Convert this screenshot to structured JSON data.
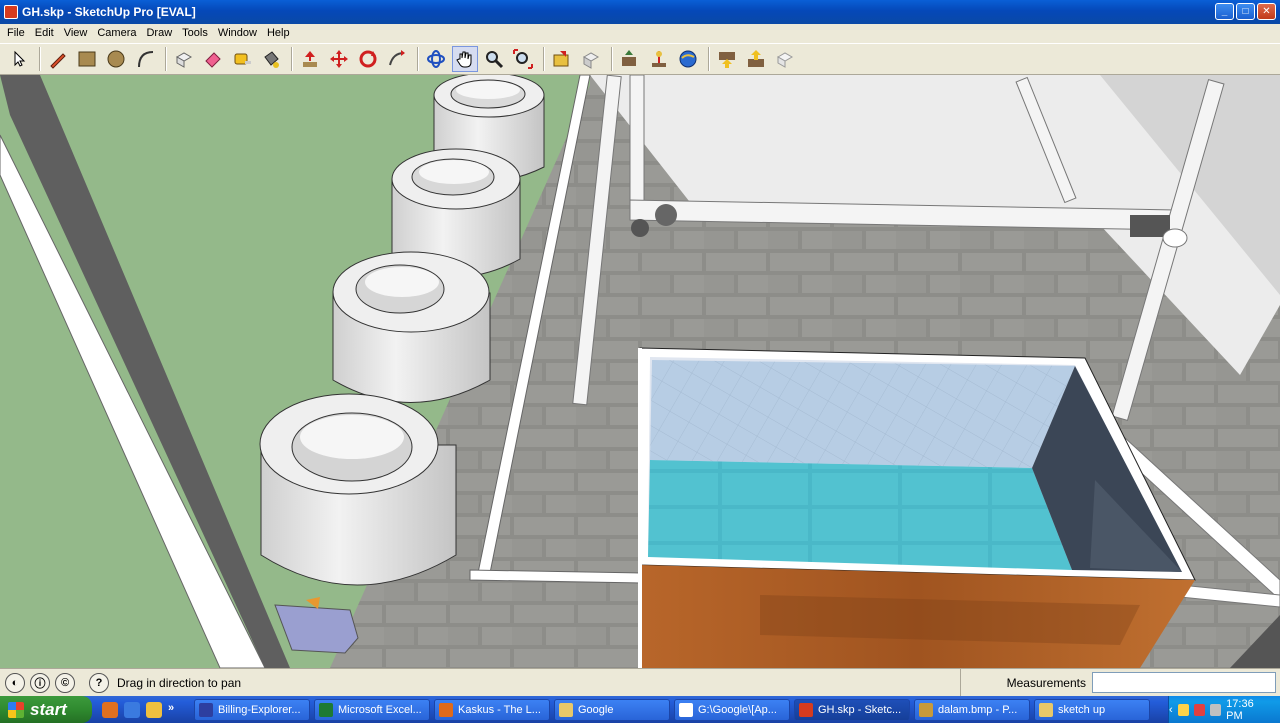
{
  "window": {
    "title": "GH.skp - SketchUp Pro [EVAL]",
    "controls": {
      "minimize": "_",
      "maximize": "□",
      "close": "✕"
    }
  },
  "menu": [
    "File",
    "Edit",
    "View",
    "Camera",
    "Draw",
    "Tools",
    "Window",
    "Help"
  ],
  "toolbar": {
    "tools": [
      {
        "name": "select-icon"
      },
      {
        "name": "pencil-icon"
      },
      {
        "name": "rectangle-icon"
      },
      {
        "name": "circle-icon"
      },
      {
        "name": "arc-icon"
      },
      {
        "name": "make-component-icon"
      },
      {
        "name": "eraser-icon"
      },
      {
        "name": "tape-measure-icon"
      },
      {
        "name": "paint-bucket-icon"
      },
      {
        "name": "push-pull-icon"
      },
      {
        "name": "move-icon"
      },
      {
        "name": "rotate-icon"
      },
      {
        "name": "follow-me-icon"
      },
      {
        "name": "orbit-icon"
      },
      {
        "name": "pan-icon",
        "active": true
      },
      {
        "name": "zoom-icon"
      },
      {
        "name": "zoom-extents-icon"
      },
      {
        "name": "get-models-icon"
      },
      {
        "name": "share-model-icon"
      },
      {
        "name": "share-component-icon"
      },
      {
        "name": "add-location-icon"
      },
      {
        "name": "google-earth-icon"
      },
      {
        "name": "import-icon"
      },
      {
        "name": "export-icon"
      },
      {
        "name": "preview-icon"
      }
    ]
  },
  "status": {
    "hint": "Drag in direction to pan",
    "help_icon": "?",
    "measurements_label": "Measurements",
    "measurements_value": ""
  },
  "taskbar": {
    "start_label": "start",
    "more_arrow": "»",
    "tasks": [
      {
        "label": "Billing-Explorer...",
        "color": "#2d3fa0"
      },
      {
        "label": "Microsoft Excel...",
        "color": "#1e7a33"
      },
      {
        "label": "Kaskus - The L...",
        "color": "#e06a1a"
      },
      {
        "label": "Google",
        "color": "#e8c86a"
      },
      {
        "label": "G:\\Google\\[Ap...",
        "color": "#ffffff"
      },
      {
        "label": "GH.skp - Sketc...",
        "color": "#d63b1f",
        "active": true
      },
      {
        "label": "dalam.bmp - P...",
        "color": "#c79a3a"
      },
      {
        "label": "sketch up",
        "color": "#e8c86a"
      }
    ],
    "tray_arrow": "‹",
    "clock": "17:36 PM"
  }
}
